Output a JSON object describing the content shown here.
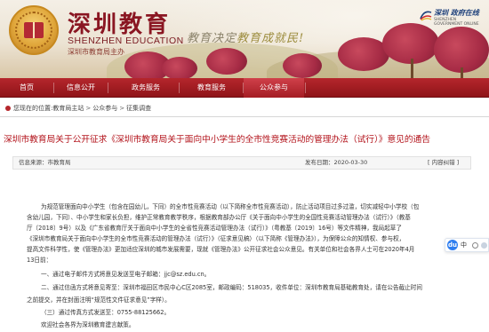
{
  "header": {
    "site_title": "深圳教育",
    "site_title_en": "SHENZHEN EDUCATION",
    "sponsor": "深圳市教育局主办",
    "slogan_part1": "教育决定",
    "slogan_part2": "教育成就民!",
    "corner_logo_zh": "深圳 政府在线",
    "corner_logo_en": "SHENZHEN GOVERNMENT ONLINE"
  },
  "nav": {
    "items": [
      "首页",
      "信息公开",
      "政务服务",
      "教育服务",
      "公众参与",
      "专题专栏"
    ],
    "active_index": 4
  },
  "breadcrumb": {
    "prefix": "您现在的位置:",
    "home": "教育局主站",
    "section": "公众参与",
    "current": "征集调查",
    "separator": ">"
  },
  "article": {
    "title": "深圳市教育局关于公开征求《深圳市教育局关于面向中小学生的全市性竞赛活动的管理办法（试行）》意见的通告",
    "source_label": "信息来源：市教育局",
    "date_label": "发布日期：2020-03-30",
    "view_label": "[ 内容纠错 ]",
    "paragraphs": [
      "为规范管理面向中小学生（包含在园幼儿，下同）的全市性竞赛活动（以下简称全市性竞赛活动），防止活动项目过多过滥，切实减轻中小学校（包",
      "含幼儿园，下同）、中小学生和家长负担，维护正常教育教学秩序，根据教育部办公厅《关于面向中小学生的全国性竞赛活动管理办法（试行）》（教基",
      "厅〔2018〕9号）以及《广东省教育厅关于面向中小学生的全省性竞赛活动管理办法（试行）》（粤教基〔2019〕16号）等文件精神，我局起草了",
      "《深圳市教育局关于面向中小学生的全市性竞赛活动的管理办法（试行）》（征求意见稿）（以下简称《管理办法》），为保障公众的知情权、参与权，",
      "提高文件科学性，使《管理办法》更加适应深圳的城市发展需要，现就《管理办法》公开征求社会公众意见。有关单位和社会各界人士可在2020年4月",
      "13日前："
    ],
    "items": [
      "一、通过电子邮件方式将意见发送至电子邮箱：jjc@sz.edu.cn。",
      "二、通过信函方式将意见寄至：深圳市福田区市民中心C区2085室，邮政编码：518035，收件单位：深圳市教育局基础教育处，请在公告截止时间",
      "之前提交，并在封面注明“规范性文件征求意见”字样）。",
      "（三）通过传真方式发送至：0755-88125662。"
    ],
    "closing": "欢迎社会各界为深圳教育建言献策。"
  },
  "side_widget": {
    "icon_letter": "du",
    "label": "中"
  },
  "colors": {
    "brand_red": "#b5262c",
    "headline_red": "#b3141c"
  }
}
